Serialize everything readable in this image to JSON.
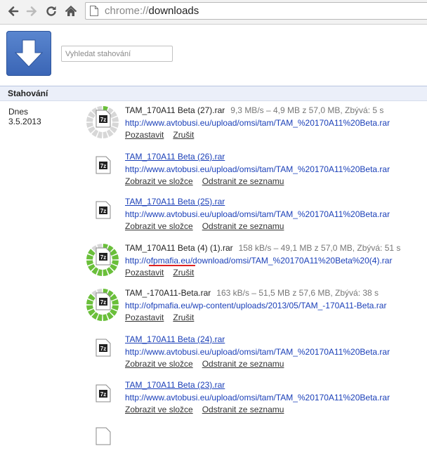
{
  "browser": {
    "omnibox": {
      "scheme": "chrome://",
      "path": "downloads"
    },
    "icons": [
      "back-icon",
      "forward-icon",
      "reload-icon",
      "home-icon",
      "page-icon"
    ]
  },
  "page": {
    "search_placeholder": "Vyhledat stahování",
    "section_title": "Stahování",
    "date_group": {
      "label": "Dnes",
      "date": "3.5.2013"
    }
  },
  "downloads": [
    {
      "name": "TAM_170A11 Beta (27).rar",
      "status": "9,3 MB/s – 4,9 MB z 57,0 MB, Zbývá: 5 s",
      "url": "http://www.avtobusi.eu/upload/omsi/tam/TAM_%20170A11%20Beta.rar",
      "actions": [
        "Pozastavit",
        "Zrušit"
      ],
      "state": "in-progress",
      "progress": 0.09
    },
    {
      "name": "TAM_170A11 Beta (26).rar",
      "status": "",
      "url": "http://www.avtobusi.eu/upload/omsi/tam/TAM_%20170A11%20Beta.rar",
      "actions": [
        "Zobrazit ve složce",
        "Odstranit ze seznamu"
      ],
      "state": "complete"
    },
    {
      "name": "TAM_170A11 Beta (25).rar",
      "status": "",
      "url": "http://www.avtobusi.eu/upload/omsi/tam/TAM_%20170A11%20Beta.rar",
      "actions": [
        "Zobrazit ve složce",
        "Odstranit ze seznamu"
      ],
      "state": "complete"
    },
    {
      "name": "TAM_170A11 Beta (4) (1).rar",
      "status": "158 kB/s – 49,1 MB z 57,0 MB, Zbývá: 51 s",
      "url": "http://ofpmafia.eu/download/omsi/TAM_%20170A11%20Beta%20(4).rar",
      "actions": [
        "Pozastavit",
        "Zrušit"
      ],
      "state": "in-progress",
      "progress": 0.86
    },
    {
      "name": "TAM_-170A11-Beta.rar",
      "status": "163 kB/s – 51,5 MB z 57,6 MB, Zbývá: 38 s",
      "url": "http://ofpmafia.eu/wp-content/uploads/2013/05/TAM_-170A11-Beta.rar",
      "actions": [
        "Pozastavit",
        "Zrušit"
      ],
      "state": "in-progress",
      "progress": 0.89
    },
    {
      "name": "TAM_170A11 Beta (24).rar",
      "status": "",
      "url": "http://www.avtobusi.eu/upload/omsi/tam/TAM_%20170A11%20Beta.rar",
      "actions": [
        "Zobrazit ve složce",
        "Odstranit ze seznamu"
      ],
      "state": "complete"
    },
    {
      "name": "TAM_170A11 Beta (23).rar",
      "status": "",
      "url": "http://www.avtobusi.eu/upload/omsi/tam/TAM_%20170A11%20Beta.rar",
      "actions": [
        "Zobrazit ve složce",
        "Odstranit ze seznamu"
      ],
      "state": "complete"
    }
  ],
  "colors": {
    "link": "#1a3fb8",
    "progress_done": "#6abf3a",
    "progress_todo": "#d7d7d7",
    "annotation": "#d22222"
  }
}
